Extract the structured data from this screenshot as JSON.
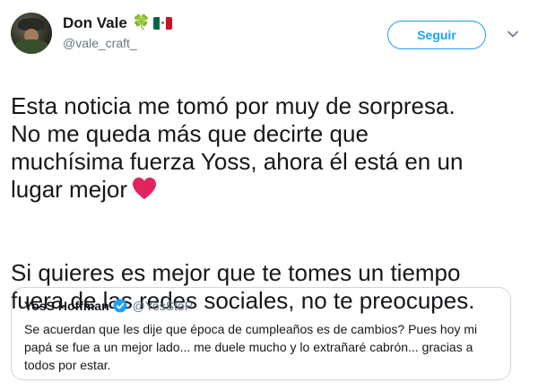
{
  "author": {
    "display_name": "Don Vale",
    "emoji": "🍀",
    "handle": "@vale_craft_"
  },
  "follow_button": {
    "label": "Seguir"
  },
  "tweet": {
    "paragraph_1": "Esta noticia me tomó por muy de sorpresa.\nNo me queda más que decirte que\nmuchísima fuerza Yoss, ahora él está en un\nlugar mejor",
    "paragraph_2": "Si quieres es mejor que te tomes un tiempo\nfuera de las redes sociales, no te preocupes."
  },
  "quoted_tweet": {
    "display_name": "YosS Hoffman",
    "handle": "@YosStoP",
    "text": "Se acuerdan que les dije que época de cumpleaños es de cambios? Pues hoy mi papá se fue a un mejor lado... me duele mucho y lo extrañaré cabrón... gracias a todos por estar."
  },
  "colors": {
    "accent": "#1da1f2",
    "text": "#14171a",
    "secondary_text": "#657786",
    "heart": "#e0245e",
    "border": "#ccd6dd"
  }
}
